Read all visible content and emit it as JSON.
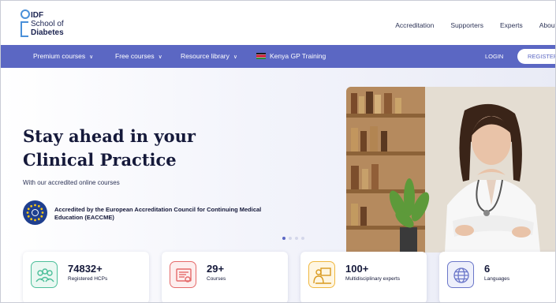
{
  "header": {
    "logo": {
      "line1": "IDF",
      "line2": "School of",
      "line3": "Diabetes"
    },
    "top_nav": [
      {
        "label": "Accreditation"
      },
      {
        "label": "Supporters"
      },
      {
        "label": "Experts"
      },
      {
        "label": "About"
      }
    ]
  },
  "navbar": {
    "items": [
      {
        "label": "Premium courses",
        "has_dropdown": true
      },
      {
        "label": "Free courses",
        "has_dropdown": true
      },
      {
        "label": "Resource library",
        "has_dropdown": true
      },
      {
        "label": "Kenya GP Training",
        "icon": "kenya-flag-icon"
      }
    ],
    "login_label": "LOGIN",
    "register_label": "REGISTER",
    "color": "#5b67c3"
  },
  "hero": {
    "title_line1": "Stay ahead in your",
    "title_line2": "Clinical Practice",
    "subtitle": "With our accredited online courses",
    "accreditation": "Accredited by the European Accreditation Council for Continuing Medical Education (EACCME)",
    "slide_count": 4,
    "active_slide": 1
  },
  "stats": [
    {
      "value": "74832+",
      "label": "Registered HCPs",
      "icon": "users-icon",
      "color": "#4cbf9a"
    },
    {
      "value": "29+",
      "label": "Courses",
      "icon": "certificate-icon",
      "color": "#e56a6a"
    },
    {
      "value": "100+",
      "label": "Multidisciplinary experts",
      "icon": "presenter-icon",
      "color": "#f0b840"
    },
    {
      "value": "6",
      "label": "Languages",
      "icon": "globe-icon",
      "color": "#6b77c9"
    }
  ]
}
